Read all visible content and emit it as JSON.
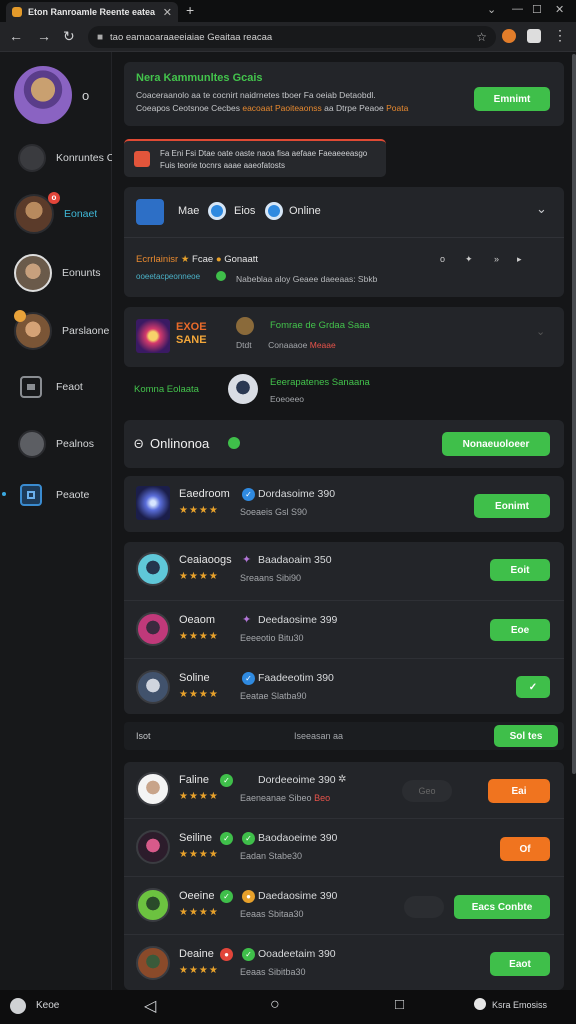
{
  "browser": {
    "tab_title": "Eton Ranroamle Reente eatea",
    "url": "tao eamaoaraaeeiaiae Geaitaa reacaa"
  },
  "sidebar": {
    "profile_indicator": "o",
    "items": [
      {
        "label": "Konruntes C"
      },
      {
        "label": "Eonaet",
        "badge": "o"
      },
      {
        "label": "Eonunts"
      },
      {
        "label": "Parslaone"
      },
      {
        "label": "Feaot"
      },
      {
        "label": "Pealnos"
      },
      {
        "label": "Peaote"
      }
    ]
  },
  "header_card": {
    "title": "Nera Kammunltes Gcais",
    "line1": "Coaceraanolo aa te cocnirt naidrnetes tboer Fa oeiab Detaobdl.",
    "line2a": "Coeapos Ceotsnoe Cecbes",
    "line2b": "eacoaat Paoiteaonss",
    "line2c": "aa",
    "line2d": "Dtrpe",
    "line2e": "Peaoe",
    "line2f": "Poata",
    "button": "Emnimt"
  },
  "alert": {
    "line1": "Fa Eni Fsi Dtae oate oaste naoa fisa aefaae Faeaeeeasgo",
    "line2": "Fuis teorie tocnrs aaae aaeofatosts"
  },
  "filter_bar": {
    "items": [
      "Mae",
      "Eios",
      "Online"
    ]
  },
  "community_card": {
    "tag1": "Ecrrlainisr",
    "tag2": "Fcae",
    "tag3": "Gonaatt",
    "sub_a": "ooeetacpeonneoe",
    "sub_b": "Nabeblaa aloy Geaee daeeaas: Sbkb",
    "icons": [
      "o",
      "✦",
      "»",
      "▸"
    ]
  },
  "feature_card": {
    "logo_line1": "EXOE",
    "logo_line2": "SANE",
    "title": "Fomrae de Grdaa Saaa",
    "sub1": "Dtdt",
    "sub2": "Conaaaoe",
    "sub3": "Meaae"
  },
  "invite_row": {
    "label": "Komna Eolaata",
    "title": "Eeerapatenes Sanaana",
    "sub": "Eoeoeeo"
  },
  "online_section": {
    "title": "Onlinonoa",
    "button": "Nonaeuoloeer"
  },
  "rows_online": [
    {
      "name": "Eaedroom",
      "status": "Dordasoime 390",
      "sub": "Soeaeis Gsl S90",
      "rating": 4,
      "button": "Eonimt"
    },
    {
      "name": "Ceaiaoogs",
      "status": "Baadaoaim 350",
      "sub": "Sreaans Sibi90",
      "rating": 4,
      "button": "Eoit"
    },
    {
      "name": "Oeaom",
      "status": "Deedaosime 399",
      "sub": "Eeeeotio Bitu30",
      "rating": 4,
      "button": "Eoe"
    },
    {
      "name": "Soline",
      "status": "Faadeeotim 390",
      "sub": "Eeatae Slatba90",
      "rating": 4,
      "button": "✓"
    }
  ],
  "section_divider": {
    "left": "Isot",
    "center": "Iseeasan aa",
    "button": "Sol tes"
  },
  "rows_offline": [
    {
      "name": "Faline",
      "status": "Dordeeoime 390",
      "sub": "Eaeneanae Sibeo",
      "sub_tag": "Beo",
      "rating": 4,
      "pill": "Geo",
      "button": "Eai",
      "button_color": "orange"
    },
    {
      "name": "Seiline",
      "status": "Baodaoeime 390",
      "sub": "Eadan Stabe30",
      "rating": 4,
      "button": "Of",
      "button_color": "orange"
    },
    {
      "name": "Oeeine",
      "status": "Daedaosime 390",
      "sub": "Eeaas Sbitaa30",
      "rating": 4,
      "pill": "",
      "button": "Eacs Conbte",
      "button_color": "green"
    },
    {
      "name": "Deaine",
      "status": "Ooadeetaim 390",
      "sub": "Eeaas Sibitba30",
      "rating": 4,
      "button": "Eaot",
      "button_color": "green"
    }
  ],
  "bottom_bar": {
    "left_label": "Keoe",
    "right_label": "Ksra Emosiss"
  },
  "colors": {
    "accent_green": "#43c34c",
    "accent_orange": "#f0741f",
    "accent_red": "#e7534a",
    "background": "#151618",
    "card": "#232529"
  }
}
